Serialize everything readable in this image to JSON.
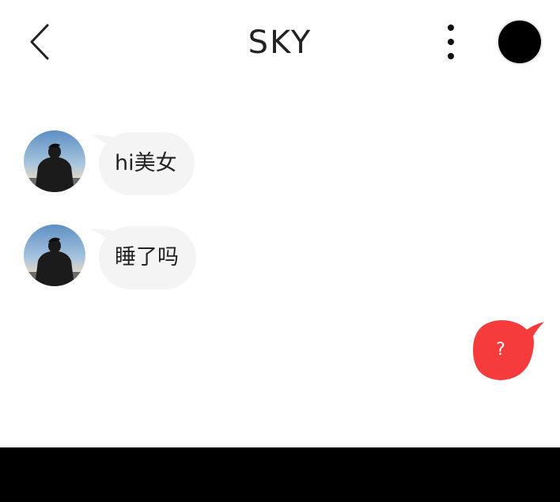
{
  "header": {
    "title": "SKY",
    "back_icon": "chevron-left-icon",
    "more_icon": "more-vertical-icon",
    "avatar_color": "#000000"
  },
  "messages": [
    {
      "sender": "other",
      "text": "hi美女"
    },
    {
      "sender": "other",
      "text": "睡了吗"
    }
  ],
  "fab": {
    "label": "?",
    "color": "#f53b3b"
  },
  "colors": {
    "bubble_bg": "#f4f4f4",
    "text": "#222222",
    "bottom_bar": "#000000"
  }
}
